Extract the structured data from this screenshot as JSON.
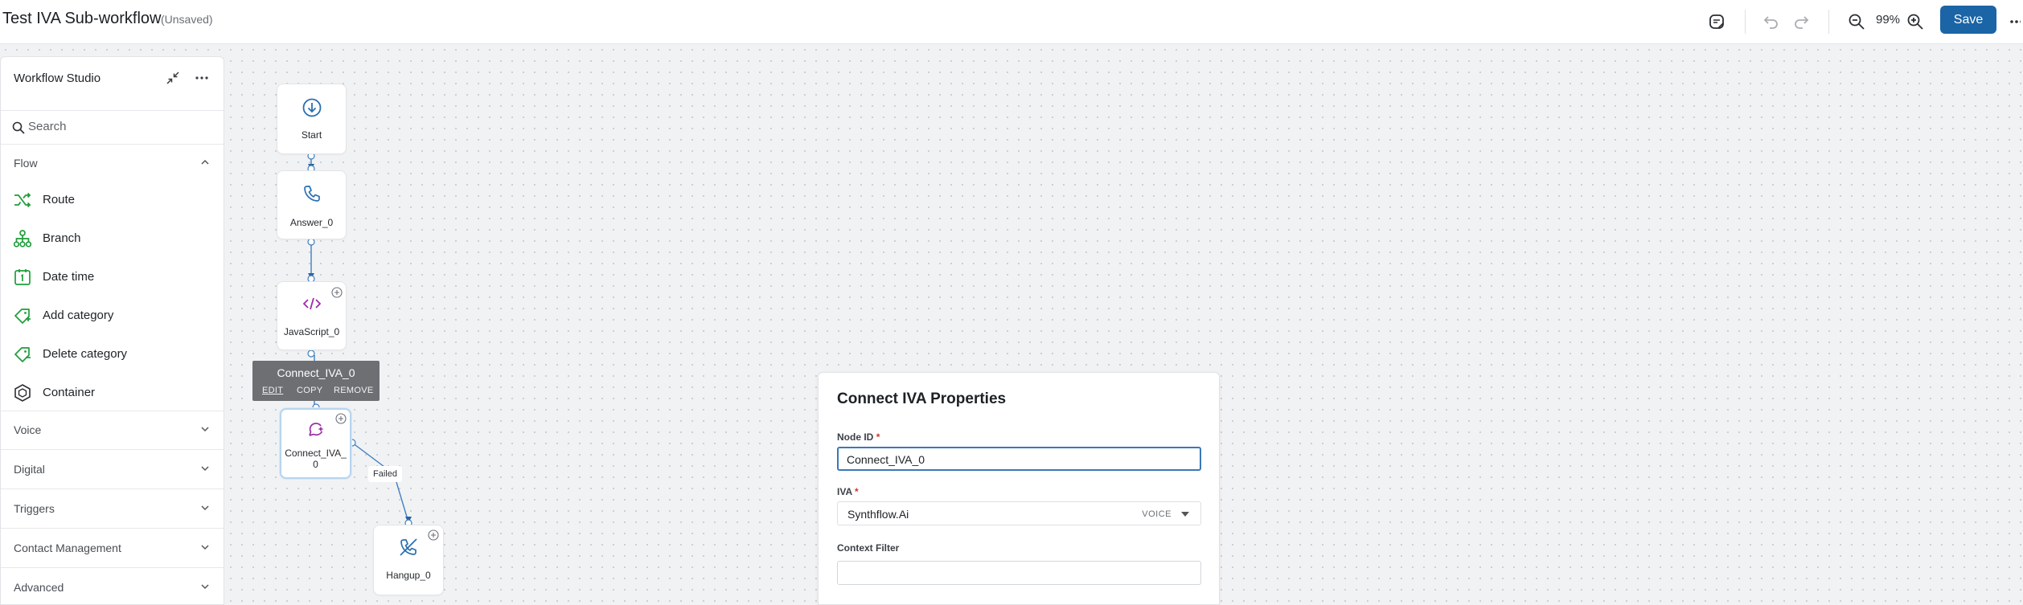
{
  "header": {
    "title": "Test IVA Sub-workflow",
    "status": "(Unsaved)",
    "zoom": "99%",
    "save_label": "Save",
    "icons": [
      "sticky-note-icon",
      "undo-icon",
      "redo-icon",
      "zoom-out-icon",
      "zoom-in-icon",
      "more-icon"
    ]
  },
  "sidebar": {
    "title": "Workflow Studio",
    "search_placeholder": "Search",
    "flow": {
      "label": "Flow",
      "items": [
        {
          "label": "Route",
          "icon": "shuffle-icon"
        },
        {
          "label": "Branch",
          "icon": "hierarchy-icon"
        },
        {
          "label": "Date time",
          "icon": "calendar-icon"
        },
        {
          "label": "Add category",
          "icon": "tag-add-icon"
        },
        {
          "label": "Delete category",
          "icon": "tag-remove-icon"
        },
        {
          "label": "Container",
          "icon": "container-icon"
        }
      ]
    },
    "sections": [
      "Voice",
      "Digital",
      "Triggers",
      "Contact Management",
      "Advanced"
    ]
  },
  "canvas": {
    "nodes": {
      "start": "Start",
      "answer": "Answer_0",
      "javascript": "JavaScript_0",
      "connect_iva": "Connect_IVA_\n0",
      "hangup": "Hangup_0"
    },
    "tooltip": {
      "name": "Connect_IVA_0",
      "edit": "EDIT",
      "copy": "COPY",
      "remove": "REMOVE"
    },
    "edge_label": "Failed"
  },
  "properties": {
    "title": "Connect IVA Properties",
    "node_id_label": "Node ID",
    "node_id_value": "Connect_IVA_0",
    "iva_label": "IVA",
    "iva_value": "Synthflow.Ai",
    "iva_tag": "VOICE",
    "context_filter_label": "Context Filter",
    "context_filter_value": "",
    "required_marker": "*"
  },
  "colors": {
    "accent": "#1b64a6",
    "flow_icon_green": "#1f9d3a",
    "node_icon_blue": "#2a6fb0",
    "node_icon_purple": "#9a2fa5"
  }
}
